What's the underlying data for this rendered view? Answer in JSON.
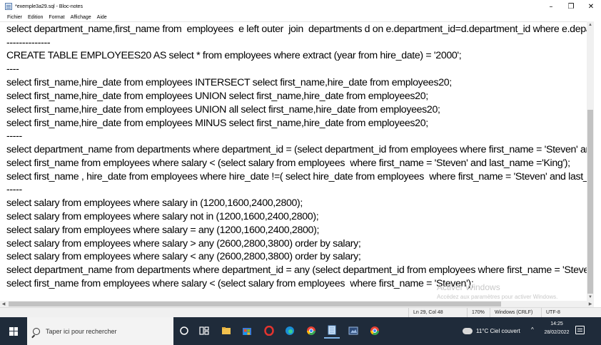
{
  "window": {
    "title": "*exemple3a29.sql - Bloc-notes",
    "minimize": "–",
    "maximize": "❐",
    "close": "✕"
  },
  "menu": [
    "Fichier",
    "Edition",
    "Format",
    "Affichage",
    "Aide"
  ],
  "editor": {
    "lines": [
      "select department_name,first_name from  employees  e left outer  join  departments d on e.department_id=d.department_id where e.department_id",
      "--------------",
      "CREATE TABLE EMPLOYEES20 AS select * from employees where extract (year from hire_date) = '2000';",
      "----",
      "select first_name,hire_date from employees INTERSECT select first_name,hire_date from employees20;",
      "select first_name,hire_date from employees UNION select first_name,hire_date from employees20;",
      "select first_name,hire_date from employees UNION all select first_name,hire_date from employees20;",
      "select first_name,hire_date from employees MINUS select first_name,hire_date from employees20;",
      "-----",
      "select department_name from departments where department_id = (select department_id from employees where first_name = 'Steven' and last_name",
      "select first_name from employees where salary < (select salary from employees  where first_name = 'Steven' and last_name ='King');",
      "select first_name , hire_date from employees where hire_date !=( select hire_date from employees  where first_name = 'Steven' and last_name",
      "-----",
      "select salary from employees where salary in (1200,1600,2400,2800);",
      "select salary from employees where salary not in (1200,1600,2400,2800);",
      "select salary from employees where salary = any (1200,1600,2400,2800);",
      "select salary from employees where salary > any (2600,2800,3800) order by salary;",
      "select salary from employees where salary < any (2600,2800,3800) order by salary;",
      "select department_name from departments where department_id = any (select department_id from employees where first_name = 'Steven' )",
      "select first_name from employees where salary < (select salary from employees  where first_name = 'Steven');"
    ]
  },
  "watermark": {
    "line1": "Activer Windows",
    "line2": "Accédez aux paramètres pour activer Windows."
  },
  "status": {
    "position": "Ln 29, Col 48",
    "zoom": "170%",
    "line_endings": "Windows (CRLF)",
    "encoding": "UTF-8"
  },
  "taskbar": {
    "search_placeholder": "Taper ici pour rechercher",
    "weather": "11°C  Ciel couvert",
    "time": "14:25",
    "date": "28/02/2022",
    "chevron": "^",
    "icons": [
      "task-view",
      "widgets",
      "file-explorer",
      "store",
      "opera",
      "edge",
      "chrome-alt",
      "notepad",
      "media",
      "chrome"
    ]
  },
  "colors": {
    "taskbar": "#1f2b3a",
    "accent": "#7fb3e6"
  }
}
